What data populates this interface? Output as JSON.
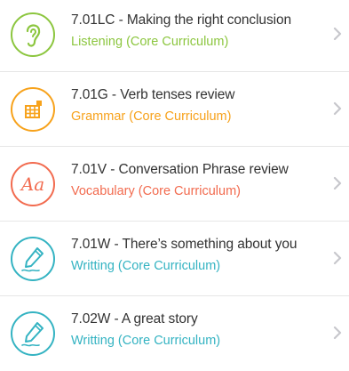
{
  "lessons": [
    {
      "title": "7.01LC - Making the right conclusion",
      "subtitle": "Listening (Core Curriculum)",
      "icon": "ear-icon",
      "color": "#8cc63f"
    },
    {
      "title": "7.01G - Verb tenses review",
      "subtitle": "Grammar (Core Curriculum)",
      "icon": "grammar-grid-icon",
      "color": "#f7a21b"
    },
    {
      "title": "7.01V - Conversation Phrase review",
      "subtitle": "Vocabulary (Core Curriculum)",
      "icon": "vocabulary-aa-icon",
      "icon_text": "Aa",
      "color": "#f26b4f"
    },
    {
      "title": "7.01W - There’s something about you",
      "subtitle": "Writting (Core Curriculum)",
      "icon": "pen-icon",
      "color": "#34b3c2"
    },
    {
      "title": "7.02W - A great story",
      "subtitle": "Writting (Core Curriculum)",
      "icon": "pen-icon",
      "color": "#34b3c2"
    }
  ],
  "colors": {
    "title_text": "#333333",
    "chevron": "#c7c7cc",
    "divider": "#e6e6e6"
  },
  "chevron_icon": "chevron-right-icon"
}
